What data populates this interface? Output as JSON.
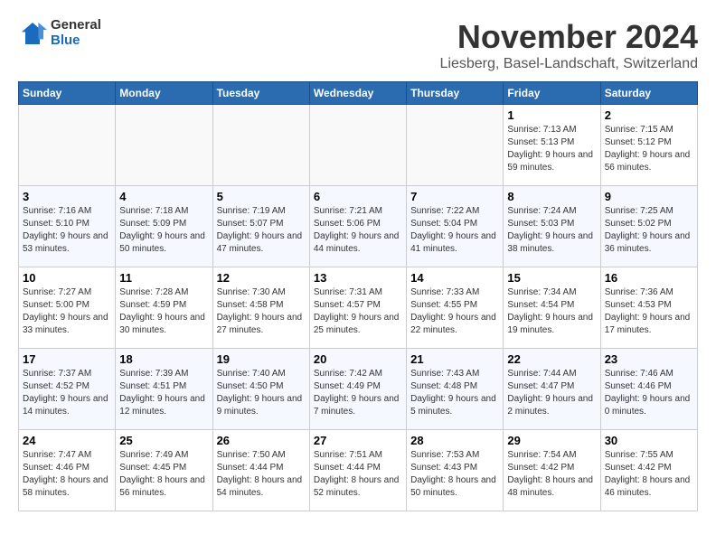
{
  "header": {
    "logo_general": "General",
    "logo_blue": "Blue",
    "month_title": "November 2024",
    "location": "Liesberg, Basel-Landschaft, Switzerland"
  },
  "days_of_week": [
    "Sunday",
    "Monday",
    "Tuesday",
    "Wednesday",
    "Thursday",
    "Friday",
    "Saturday"
  ],
  "weeks": [
    [
      {
        "day": "",
        "info": ""
      },
      {
        "day": "",
        "info": ""
      },
      {
        "day": "",
        "info": ""
      },
      {
        "day": "",
        "info": ""
      },
      {
        "day": "",
        "info": ""
      },
      {
        "day": "1",
        "info": "Sunrise: 7:13 AM\nSunset: 5:13 PM\nDaylight: 9 hours and 59 minutes."
      },
      {
        "day": "2",
        "info": "Sunrise: 7:15 AM\nSunset: 5:12 PM\nDaylight: 9 hours and 56 minutes."
      }
    ],
    [
      {
        "day": "3",
        "info": "Sunrise: 7:16 AM\nSunset: 5:10 PM\nDaylight: 9 hours and 53 minutes."
      },
      {
        "day": "4",
        "info": "Sunrise: 7:18 AM\nSunset: 5:09 PM\nDaylight: 9 hours and 50 minutes."
      },
      {
        "day": "5",
        "info": "Sunrise: 7:19 AM\nSunset: 5:07 PM\nDaylight: 9 hours and 47 minutes."
      },
      {
        "day": "6",
        "info": "Sunrise: 7:21 AM\nSunset: 5:06 PM\nDaylight: 9 hours and 44 minutes."
      },
      {
        "day": "7",
        "info": "Sunrise: 7:22 AM\nSunset: 5:04 PM\nDaylight: 9 hours and 41 minutes."
      },
      {
        "day": "8",
        "info": "Sunrise: 7:24 AM\nSunset: 5:03 PM\nDaylight: 9 hours and 38 minutes."
      },
      {
        "day": "9",
        "info": "Sunrise: 7:25 AM\nSunset: 5:02 PM\nDaylight: 9 hours and 36 minutes."
      }
    ],
    [
      {
        "day": "10",
        "info": "Sunrise: 7:27 AM\nSunset: 5:00 PM\nDaylight: 9 hours and 33 minutes."
      },
      {
        "day": "11",
        "info": "Sunrise: 7:28 AM\nSunset: 4:59 PM\nDaylight: 9 hours and 30 minutes."
      },
      {
        "day": "12",
        "info": "Sunrise: 7:30 AM\nSunset: 4:58 PM\nDaylight: 9 hours and 27 minutes."
      },
      {
        "day": "13",
        "info": "Sunrise: 7:31 AM\nSunset: 4:57 PM\nDaylight: 9 hours and 25 minutes."
      },
      {
        "day": "14",
        "info": "Sunrise: 7:33 AM\nSunset: 4:55 PM\nDaylight: 9 hours and 22 minutes."
      },
      {
        "day": "15",
        "info": "Sunrise: 7:34 AM\nSunset: 4:54 PM\nDaylight: 9 hours and 19 minutes."
      },
      {
        "day": "16",
        "info": "Sunrise: 7:36 AM\nSunset: 4:53 PM\nDaylight: 9 hours and 17 minutes."
      }
    ],
    [
      {
        "day": "17",
        "info": "Sunrise: 7:37 AM\nSunset: 4:52 PM\nDaylight: 9 hours and 14 minutes."
      },
      {
        "day": "18",
        "info": "Sunrise: 7:39 AM\nSunset: 4:51 PM\nDaylight: 9 hours and 12 minutes."
      },
      {
        "day": "19",
        "info": "Sunrise: 7:40 AM\nSunset: 4:50 PM\nDaylight: 9 hours and 9 minutes."
      },
      {
        "day": "20",
        "info": "Sunrise: 7:42 AM\nSunset: 4:49 PM\nDaylight: 9 hours and 7 minutes."
      },
      {
        "day": "21",
        "info": "Sunrise: 7:43 AM\nSunset: 4:48 PM\nDaylight: 9 hours and 5 minutes."
      },
      {
        "day": "22",
        "info": "Sunrise: 7:44 AM\nSunset: 4:47 PM\nDaylight: 9 hours and 2 minutes."
      },
      {
        "day": "23",
        "info": "Sunrise: 7:46 AM\nSunset: 4:46 PM\nDaylight: 9 hours and 0 minutes."
      }
    ],
    [
      {
        "day": "24",
        "info": "Sunrise: 7:47 AM\nSunset: 4:46 PM\nDaylight: 8 hours and 58 minutes."
      },
      {
        "day": "25",
        "info": "Sunrise: 7:49 AM\nSunset: 4:45 PM\nDaylight: 8 hours and 56 minutes."
      },
      {
        "day": "26",
        "info": "Sunrise: 7:50 AM\nSunset: 4:44 PM\nDaylight: 8 hours and 54 minutes."
      },
      {
        "day": "27",
        "info": "Sunrise: 7:51 AM\nSunset: 4:44 PM\nDaylight: 8 hours and 52 minutes."
      },
      {
        "day": "28",
        "info": "Sunrise: 7:53 AM\nSunset: 4:43 PM\nDaylight: 8 hours and 50 minutes."
      },
      {
        "day": "29",
        "info": "Sunrise: 7:54 AM\nSunset: 4:42 PM\nDaylight: 8 hours and 48 minutes."
      },
      {
        "day": "30",
        "info": "Sunrise: 7:55 AM\nSunset: 4:42 PM\nDaylight: 8 hours and 46 minutes."
      }
    ]
  ]
}
